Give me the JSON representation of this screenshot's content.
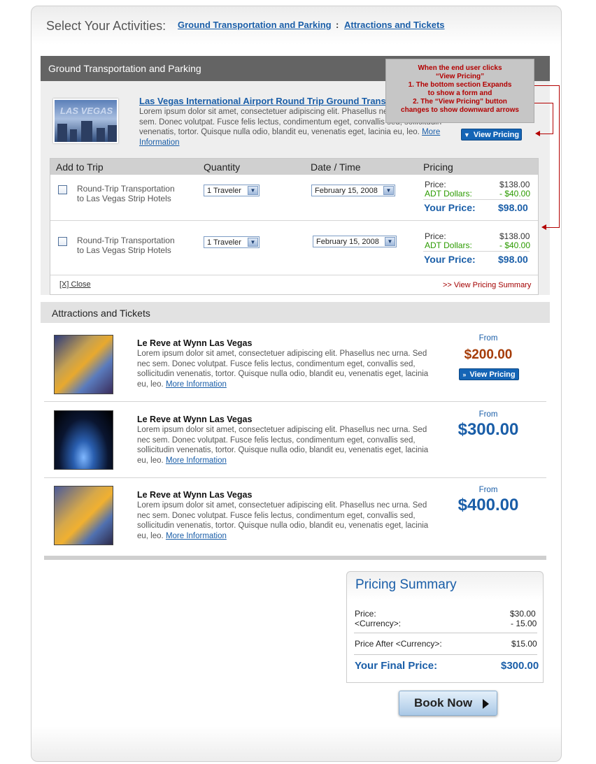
{
  "header": {
    "title": "Select Your Activities:",
    "links": [
      "Ground Transportation and Parking",
      "Attractions and Tickets"
    ],
    "separator": ":"
  },
  "ground": {
    "section_title": "Ground Transportation and Parking",
    "thumb_text": "LAS VEGAS",
    "product_title": "Las Vegas International Airport Round Trip Ground Transportation",
    "description": "Lorem ipsum dolor sit amet, consectetuer adipiscing elit. Phasellus nec urna. Sed nec sem. Donec volutpat. Fusce felis lectus, condimentum eget, convallis sed, sollicitudin venenatis, tortor. Quisque nulla odio, blandit eu, venenatis eget, lacinia eu, leo.",
    "more_info": "More Information",
    "view_pricing": "View Pricing",
    "view_pricing_icon": "double-chevron-down-icon",
    "callout": {
      "line1": "When the end user clicks",
      "line2": "“View Pricing”",
      "line3": "1. The bottom section Expands",
      "line4": "to show a form and",
      "line5": "2. The “View Pricing” button",
      "line6": "changes to show downward arrows"
    },
    "table": {
      "headers": [
        "Add to Trip",
        "Quantity",
        "Date / Time",
        "Pricing"
      ],
      "rows": [
        {
          "name_line1": "Round-Trip Transportation",
          "name_line2": "to Las Vegas Strip Hotels",
          "quantity": "1 Traveler",
          "date": "February 15, 2008",
          "price_label": "Price:",
          "price": "$138.00",
          "adt_label": "ADT Dollars:",
          "adt": "- $40.00",
          "your_price_label": "Your Price:",
          "your_price": "$98.00"
        },
        {
          "name_line1": "Round-Trip Transportation",
          "name_line2": "to Las Vegas Strip Hotels",
          "quantity": "1 Traveler",
          "date": "February 15, 2008",
          "price_label": "Price:",
          "price": "$138.00",
          "adt_label": "ADT Dollars:",
          "adt": "- $40.00",
          "your_price_label": "Your Price:",
          "your_price": "$98.00"
        }
      ],
      "close": "[X] Close",
      "view_summary": ">> View Pricing Summary"
    }
  },
  "attractions": {
    "section_title": "Attractions and Tickets",
    "items": [
      {
        "title": "Le Reve at Wynn Las Vegas",
        "description": "Lorem ipsum dolor sit amet, consectetuer adipiscing elit. Phasellus nec urna. Sed nec sem. Donec volutpat. Fusce felis lectus, condimentum eget, convallis sed, sollicitudin venenatis, tortor. Quisque nulla odio, blandit eu, venenatis eget, lacinia eu, leo.",
        "more_info": "More Information",
        "from": "From",
        "price": "$200.00",
        "button": "View Pricing",
        "button_icon": "double-chevron-right-icon"
      },
      {
        "title": "Le Reve at Wynn Las Vegas",
        "description": "Lorem ipsum dolor sit amet, consectetuer adipiscing elit. Phasellus nec urna. Sed nec sem. Donec volutpat. Fusce felis lectus, condimentum eget, convallis sed, sollicitudin venenatis, tortor. Quisque nulla odio, blandit eu, venenatis eget, lacinia eu, leo.",
        "more_info": "More Information",
        "from": "From",
        "price": "$300.00"
      },
      {
        "title": "Le Reve at Wynn Las Vegas",
        "description": "Lorem ipsum dolor sit amet, consectetuer adipiscing elit. Phasellus nec urna. Sed nec sem. Donec volutpat. Fusce felis lectus, condimentum eget, convallis sed, sollicitudin venenatis, tortor. Quisque nulla odio, blandit eu, venenatis eget, lacinia eu, leo.",
        "more_info": "More Information",
        "from": "From",
        "price": "$400.00"
      }
    ]
  },
  "summary": {
    "title": "Pricing Summary",
    "price_label": "Price:",
    "price": "$30.00",
    "currency_label": "<Currency>:",
    "currency": "- 15.00",
    "after_label": "Price After <Currency>:",
    "after": "$15.00",
    "final_label": "Your Final Price:",
    "final": "$300.00",
    "book_now": "Book Now"
  },
  "colors": {
    "link": "#1a5ea8",
    "accent_red": "#b30000",
    "green": "#2c9b00",
    "orange_price": "#a53c08"
  }
}
